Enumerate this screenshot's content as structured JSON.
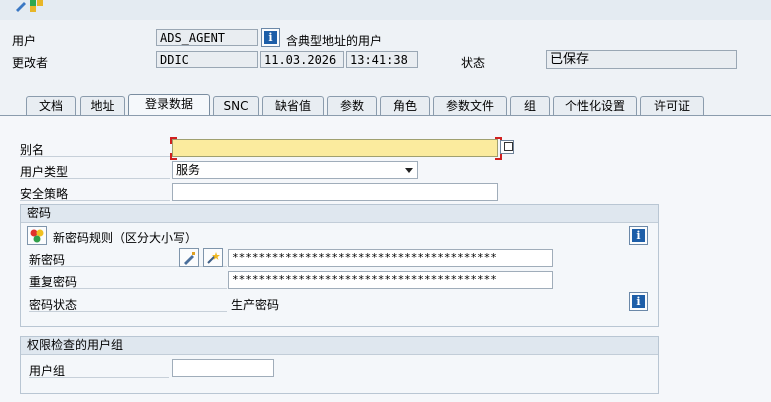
{
  "header": {
    "user_label": "用户",
    "user_value": "ADS_AGENT",
    "user_desc": "含典型地址的用户",
    "changed_by_label": "更改者",
    "changed_by_value": "DDIC",
    "date_value": "11.03.2026",
    "time_value": "13:41:38",
    "status_label": "状态",
    "status_value": "已保存"
  },
  "tabs": [
    {
      "label": "文档"
    },
    {
      "label": "地址"
    },
    {
      "label": "登录数据",
      "active": true
    },
    {
      "label": "SNC"
    },
    {
      "label": "缺省值"
    },
    {
      "label": "参数"
    },
    {
      "label": "角色"
    },
    {
      "label": "参数文件"
    },
    {
      "label": "组"
    },
    {
      "label": "个性化设置"
    },
    {
      "label": "许可证"
    }
  ],
  "logon": {
    "alias_label": "别名",
    "alias_value": "",
    "user_type_label": "用户类型",
    "user_type_value": "服务",
    "security_policy_label": "安全策略",
    "security_policy_value": ""
  },
  "password": {
    "group_title": "密码",
    "rules_text": "新密码规则（区分大小写）",
    "new_label": "新密码",
    "new_value": "****************************************",
    "repeat_label": "重复密码",
    "repeat_value": "****************************************",
    "status_label": "密码状态",
    "status_value": "生产密码"
  },
  "auth_group": {
    "group_title": "权限检查的用户组",
    "label": "用户组",
    "value": ""
  },
  "icons": {
    "info": "i"
  }
}
